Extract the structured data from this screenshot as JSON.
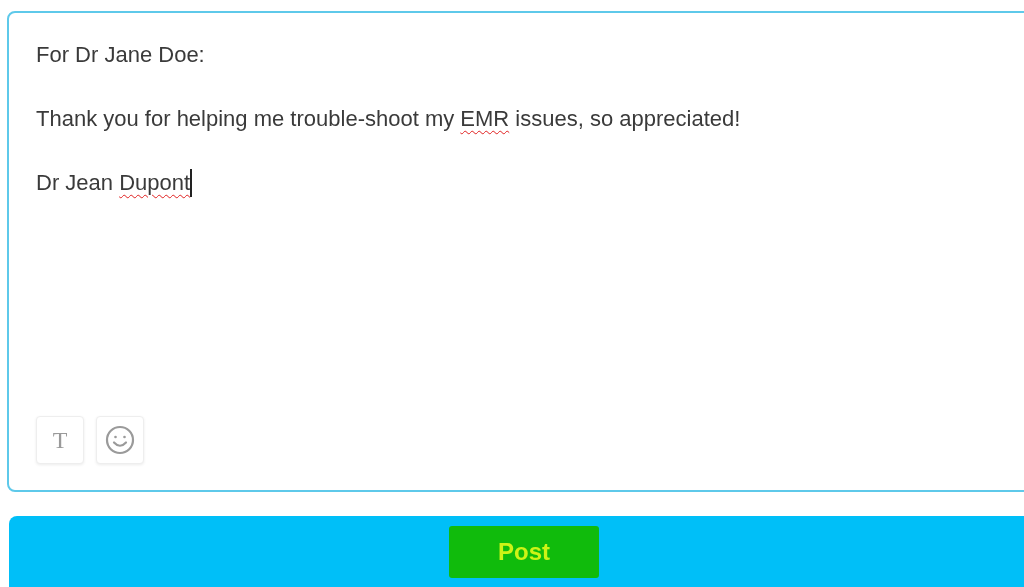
{
  "editor": {
    "lines": [
      [
        {
          "text": "For Dr Jane Doe:",
          "misspelled": false
        }
      ],
      [
        {
          "text": "Thank you for helping me trouble-shoot my ",
          "misspelled": false
        },
        {
          "text": "EMR",
          "misspelled": true
        },
        {
          "text": " issues, so appreciated!",
          "misspelled": false
        }
      ],
      [
        {
          "text": "Dr Jean ",
          "misspelled": false
        },
        {
          "text": "Dupont",
          "misspelled": true
        }
      ]
    ],
    "cursor": true,
    "toolbar": [
      {
        "kind": "text",
        "label": "T"
      },
      {
        "kind": "emoji"
      }
    ]
  },
  "post_button": {
    "label": "Post",
    "highlighted": true
  }
}
